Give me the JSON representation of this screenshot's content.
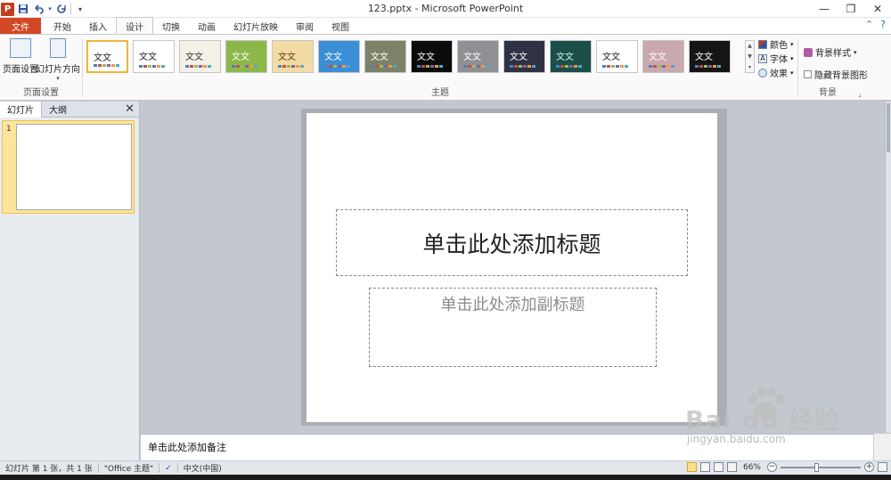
{
  "window": {
    "title": "123.pptx - Microsoft PowerPoint",
    "app_icon": "P"
  },
  "qat": {
    "icons": [
      "save-icon",
      "undo-icon",
      "redo-icon",
      "customize-icon"
    ]
  },
  "tabs": [
    {
      "label": "文件",
      "kind": "file"
    },
    {
      "label": "开始"
    },
    {
      "label": "插入"
    },
    {
      "label": "设计",
      "active": true
    },
    {
      "label": "切换"
    },
    {
      "label": "动画"
    },
    {
      "label": "幻灯片放映"
    },
    {
      "label": "审阅"
    },
    {
      "label": "视图"
    }
  ],
  "ribbon": {
    "page_setup": {
      "buttons": [
        "页面设置",
        "幻灯片方向"
      ],
      "group_label": "页面设置"
    },
    "themes": {
      "group_label": "主题",
      "sample_text": "文文",
      "items": [
        {
          "bg": "#ffffff",
          "fg": "#222222",
          "selected": true
        },
        {
          "bg": "#ffffff",
          "fg": "#222222"
        },
        {
          "bg": "#f3f0e6",
          "fg": "#333333"
        },
        {
          "bg": "#8cb84a",
          "fg": "#ffffff"
        },
        {
          "bg": "#f3dca3",
          "fg": "#5a3a12"
        },
        {
          "bg": "#3b8fd6",
          "fg": "#ffffff"
        },
        {
          "bg": "#7b8266",
          "fg": "#ffffff"
        },
        {
          "bg": "#0b0b0b",
          "fg": "#ffffff"
        },
        {
          "bg": "#8f8f95",
          "fg": "#ffffff"
        },
        {
          "bg": "#2f3244",
          "fg": "#ffffff"
        },
        {
          "bg": "#1a4f49",
          "fg": "#d9eee8"
        },
        {
          "bg": "#ffffff",
          "fg": "#222222"
        },
        {
          "bg": "#caa9ae",
          "fg": "#ffffff"
        },
        {
          "bg": "#151515",
          "fg": "#ffffff"
        }
      ],
      "options": [
        "颜色",
        "字体",
        "效果"
      ]
    },
    "background": {
      "group_label": "背景",
      "style_label": "背景样式",
      "hide_label": "隐藏背景图形"
    }
  },
  "left_pane": {
    "tabs": [
      "幻灯片",
      "大纲"
    ],
    "slides": [
      {
        "number": "1"
      }
    ]
  },
  "slide": {
    "title_placeholder": "单击此处添加标题",
    "subtitle_placeholder": "单击此处添加副标题"
  },
  "notes": {
    "placeholder": "单击此处添加备注"
  },
  "status": {
    "slide_info": "幻灯片 第 1 张，共 1 张",
    "theme": "\"Office 主题\"",
    "language": "中文(中国)",
    "zoom": "66%"
  },
  "watermark": {
    "text": "Bai du 经验",
    "sub": "jingyan.baidu.com"
  }
}
